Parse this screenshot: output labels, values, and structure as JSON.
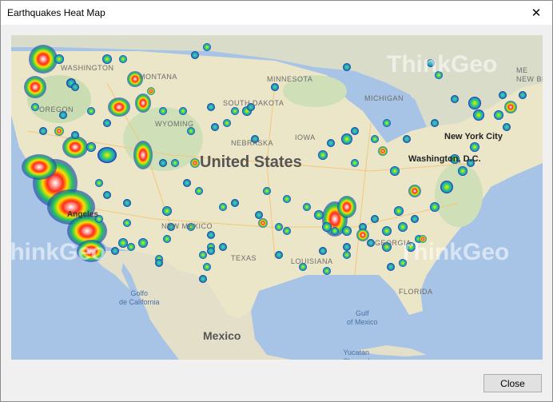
{
  "window": {
    "title": "Earthquakes Heat Map"
  },
  "footer": {
    "close_label": "Close"
  },
  "map": {
    "countries": [
      {
        "id": "us",
        "label": "United States"
      },
      {
        "id": "mx",
        "label": "Mexico"
      }
    ],
    "states": [
      {
        "id": "washington",
        "label": "WASHINGTON"
      },
      {
        "id": "montana",
        "label": "MONTANA"
      },
      {
        "id": "minnesota",
        "label": "MINNESOTA"
      },
      {
        "id": "maine",
        "label": "ME"
      },
      {
        "id": "new-brunswick",
        "label": "NEW BR"
      },
      {
        "id": "oregon",
        "label": "OREGON"
      },
      {
        "id": "south-dakota",
        "label": "SOUTH DAKOTA"
      },
      {
        "id": "michigan",
        "label": "MICHIGAN"
      },
      {
        "id": "wyoming",
        "label": "WYOMING"
      },
      {
        "id": "iowa",
        "label": "IOWA"
      },
      {
        "id": "nebraska",
        "label": "NEBRASKA"
      },
      {
        "id": "new-mexico",
        "label": "NEW MEXICO"
      },
      {
        "id": "texas",
        "label": "TEXAS"
      },
      {
        "id": "louisiana",
        "label": "LOUISIANA"
      },
      {
        "id": "georgia",
        "label": "GEORGIA"
      },
      {
        "id": "florida",
        "label": "FLORIDA"
      }
    ],
    "cities": [
      {
        "id": "new-york",
        "label": "New York City"
      },
      {
        "id": "washington-dc",
        "label": "Washington, D.C."
      },
      {
        "id": "los-angeles",
        "label": "Angeles"
      }
    ],
    "water": [
      {
        "id": "gulf-california",
        "label": "Golfo\nde California"
      },
      {
        "id": "gulf-mexico",
        "label": "Gulf\nof Mexico"
      },
      {
        "id": "yucatan",
        "label": "Yucatan\nChannel"
      }
    ],
    "watermarks": [
      "ThinkGeo",
      "ThinkGeo",
      "ThinkGeo",
      "ThinkGeo"
    ]
  }
}
